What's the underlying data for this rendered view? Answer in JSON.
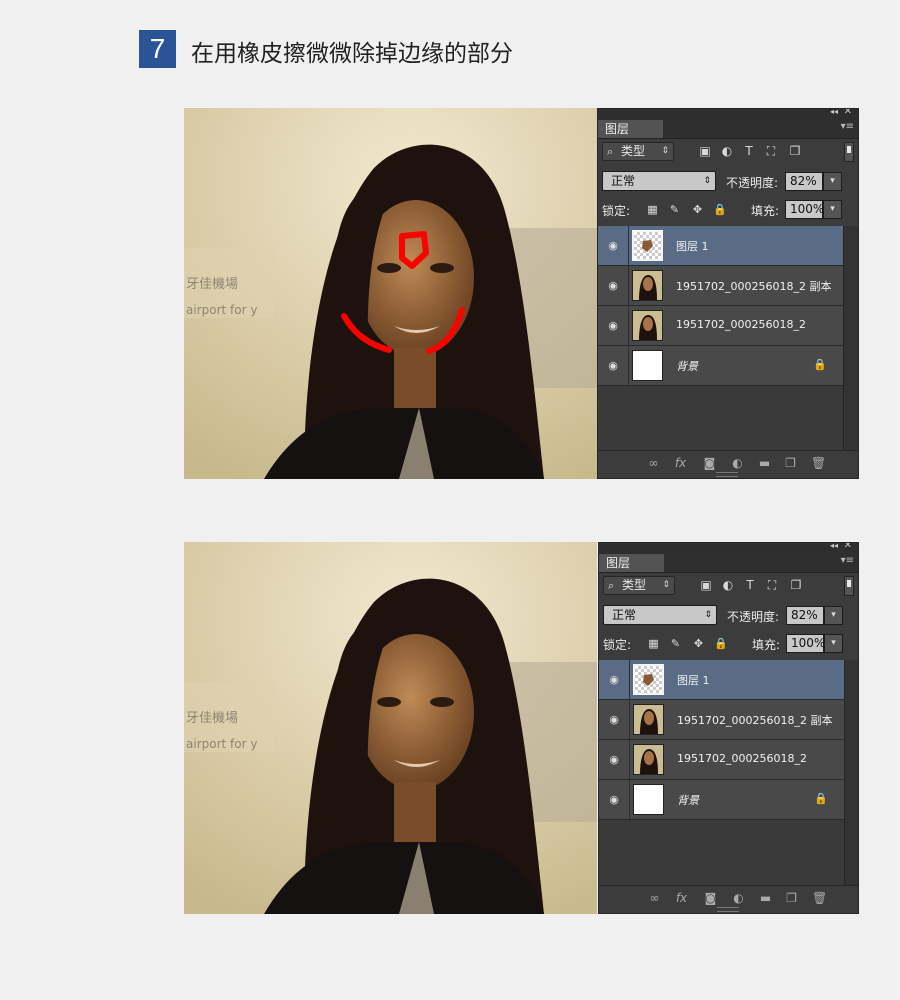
{
  "step": {
    "number": "7",
    "title": "在用橡皮擦微微除掉边缘的部分"
  },
  "layers_panel": {
    "tab_label": "图层",
    "collapse_glyph": "◂◂",
    "close_glyph": "✕",
    "menu_glyph": "▾≡",
    "filter_label": "类型",
    "filter_icons": [
      "image-filter-icon",
      "adjustment-filter-icon",
      "type-filter-icon",
      "shape-filter-icon",
      "smart-object-filter-icon"
    ],
    "blend_mode": "正常",
    "opacity_label": "不透明度:",
    "opacity_value": "82%",
    "lock_label": "锁定:",
    "fill_label": "填充:",
    "fill_value": "100%",
    "layers": [
      {
        "name": "图层 1",
        "selected": true,
        "thumb": "transparent-face-patch",
        "locked": false
      },
      {
        "name": "1951702_000256018_2 副本",
        "selected": false,
        "thumb": "portrait",
        "locked": false
      },
      {
        "name": "1951702_000256018_2",
        "selected": false,
        "thumb": "portrait",
        "locked": false
      },
      {
        "name": "背景",
        "selected": false,
        "thumb": "white",
        "locked": true
      }
    ],
    "footer_icons": [
      "link-layers-icon",
      "fx-icon",
      "layer-mask-icon",
      "adjustment-layer-icon",
      "group-folder-icon",
      "new-layer-icon",
      "trash-icon"
    ],
    "fx_text": "fx"
  },
  "annotations": {
    "marker_color": "#ff0000"
  },
  "colors": {
    "badge": "#2a5496",
    "selected_layer": "#596b85",
    "panel": "#3c3c3c"
  },
  "photo_background_sign": {
    "line1": "牙佳機場",
    "line2": "airport for y"
  }
}
